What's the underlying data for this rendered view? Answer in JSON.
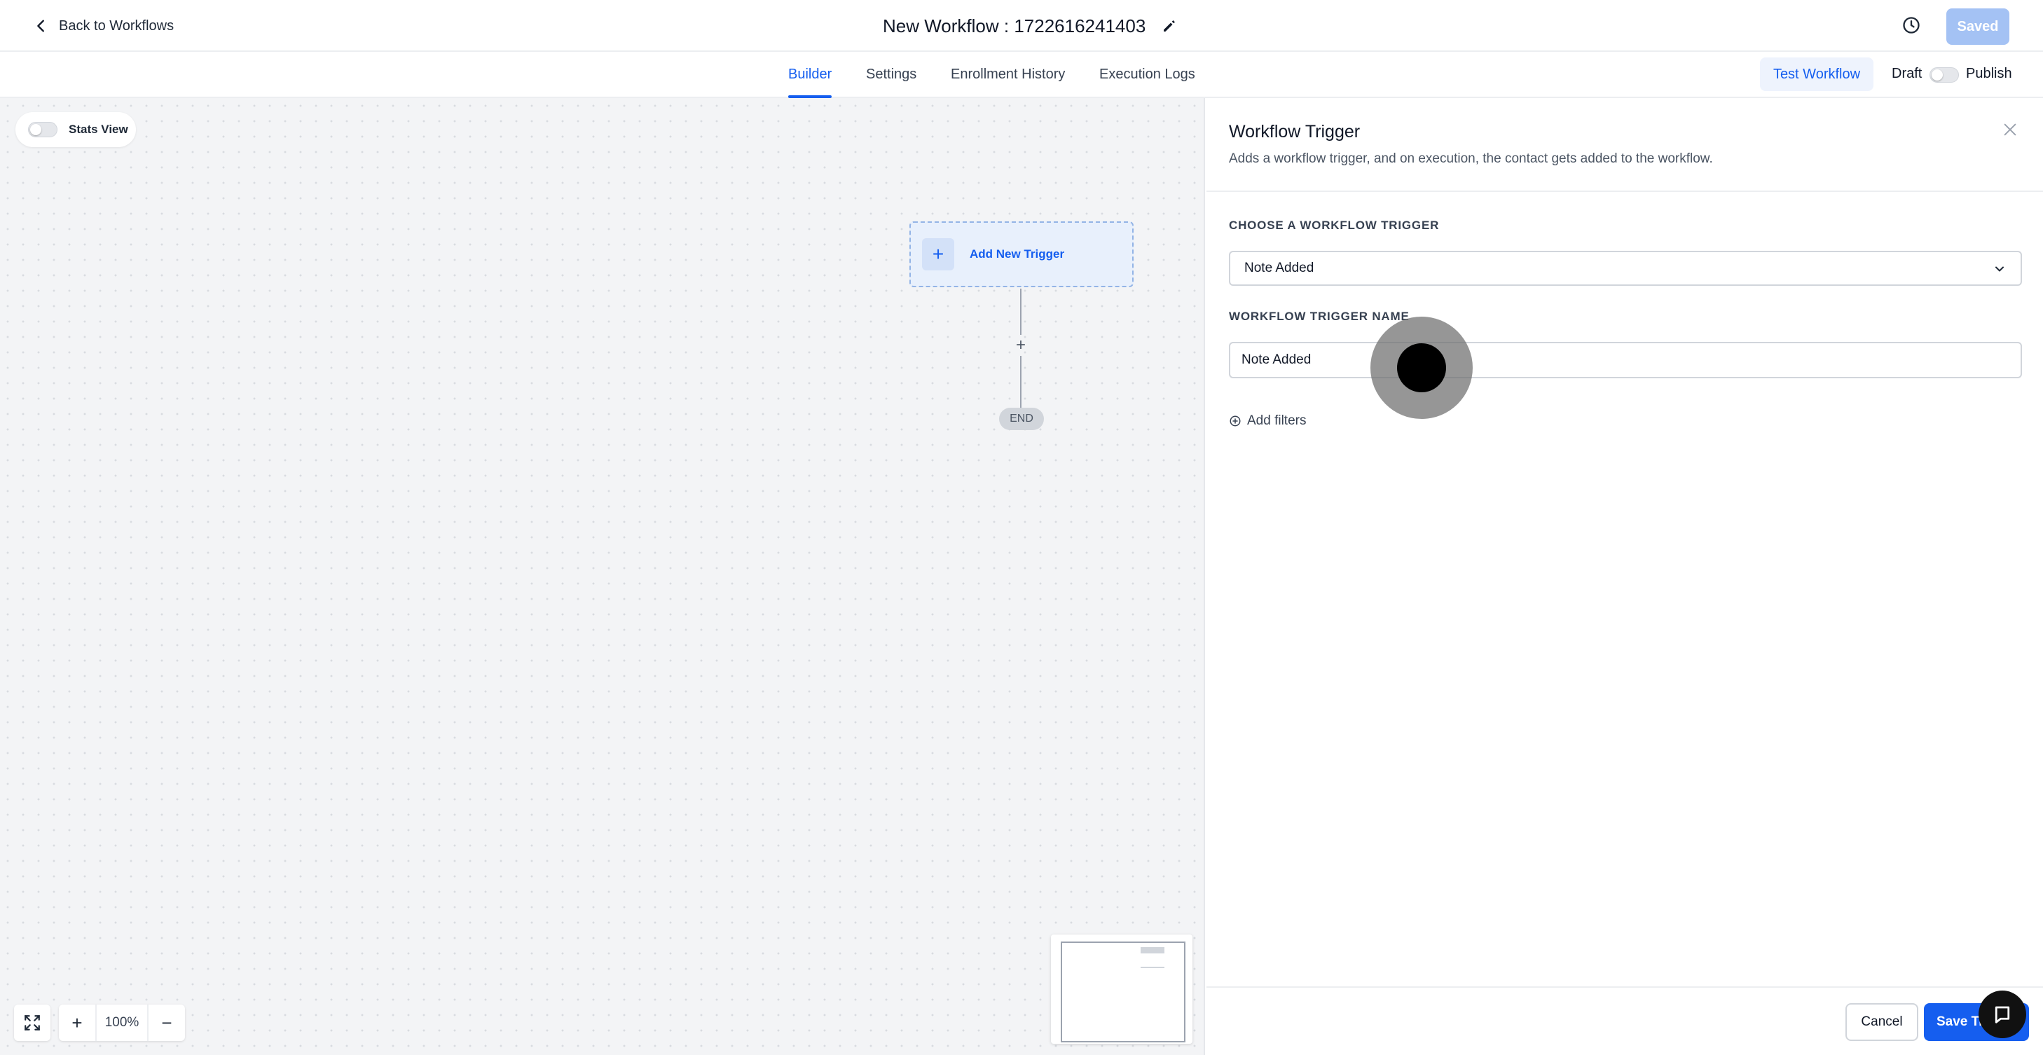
{
  "header": {
    "back_label": "Back to Workflows",
    "workflow_title": "New Workflow : 1722616241403",
    "saved_label": "Saved"
  },
  "tabs": [
    {
      "label": "Builder",
      "active": true
    },
    {
      "label": "Settings",
      "active": false
    },
    {
      "label": "Enrollment History",
      "active": false
    },
    {
      "label": "Execution Logs",
      "active": false
    }
  ],
  "actions": {
    "test_label": "Test Workflow",
    "draft_label": "Draft",
    "publish_label": "Publish",
    "published": false
  },
  "canvas": {
    "stats_view_label": "Stats View",
    "stats_view_on": false,
    "trigger_node_label": "Add New Trigger",
    "end_label": "END",
    "zoom_level": "100%"
  },
  "panel": {
    "title": "Workflow Trigger",
    "description": "Adds a workflow trigger, and on execution, the contact gets added to the workflow.",
    "choose_label": "CHOOSE A WORKFLOW TRIGGER",
    "selected_trigger": "Note Added",
    "name_label": "WORKFLOW TRIGGER NAME",
    "name_value": "Note Added",
    "add_filters_label": "Add filters",
    "cancel_label": "Cancel",
    "save_label": "Save Trigger"
  },
  "icons": {
    "back": "chevron-left-icon",
    "edit": "pencil-icon",
    "history": "clock-history-icon",
    "close": "close-icon",
    "dropdown": "chevron-down-icon",
    "add_filter": "plus-circle-icon",
    "fit": "expand-icon",
    "chat": "chat-icon"
  },
  "colors": {
    "accent": "#155eef",
    "saved_disabled": "#a4c2f4",
    "canvas_bg": "#f3f4f6"
  }
}
